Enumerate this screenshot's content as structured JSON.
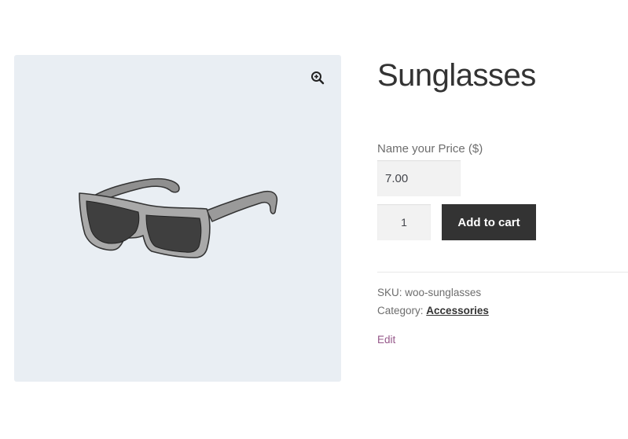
{
  "product": {
    "title": "Sunglasses",
    "price_label": "Name your Price ($)",
    "price_value": "7.00",
    "quantity": "1",
    "add_to_cart_label": "Add to cart",
    "sku_label": "SKU:",
    "sku_value": "woo-sunglasses",
    "category_label": "Category:",
    "category_value": "Accessories",
    "edit_label": "Edit"
  },
  "icons": {
    "zoom": "zoom-in-icon"
  },
  "colors": {
    "gallery_bg": "#e9eef3",
    "button_bg": "#333333",
    "edit_link": "#96588a"
  }
}
